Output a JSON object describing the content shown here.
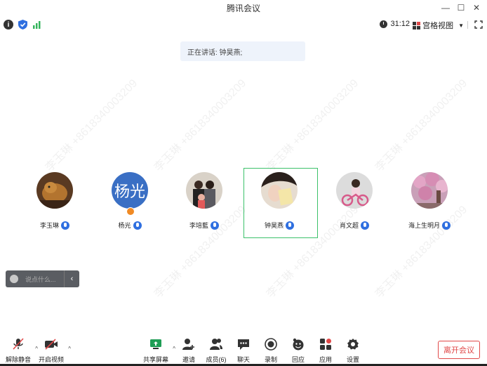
{
  "window": {
    "title": "腾讯会议",
    "minimize": "—",
    "maximize": "☐",
    "close": "✕"
  },
  "status": {
    "timer": "31:12",
    "view_label": "宫格视图",
    "shield_color": "#2f6fe0",
    "signal_color": "#35b45c"
  },
  "speaking": {
    "text": "正在讲话: 钟昊燕;"
  },
  "watermark": "李玉琳 +8618340003209",
  "participants": [
    {
      "name": "李玉琳",
      "avatar": "photo"
    },
    {
      "name": "杨光",
      "avatar": "杨光"
    },
    {
      "name": "李培藍",
      "avatar": "photo"
    },
    {
      "name": "钟昊燕",
      "avatar": "photo"
    },
    {
      "name": "肖文超",
      "avatar": "photo"
    },
    {
      "name": "海上生明月",
      "avatar": "photo"
    }
  ],
  "chat": {
    "placeholder": "说点什么...",
    "collapse_icon": "‹"
  },
  "toolbar": {
    "unmute": "解除静音",
    "start_video": "开启视频",
    "share_screen": "共享屏幕",
    "invite": "邀请",
    "members": "成员(6)",
    "chat": "聊天",
    "record": "录制",
    "replay": "回应",
    "apps": "应用",
    "settings": "设置",
    "leave": "离开会议",
    "caret": "^"
  },
  "colors": {
    "accent": "#2f6fe0",
    "active_border": "#3cc16a",
    "leave": "#e04848"
  }
}
